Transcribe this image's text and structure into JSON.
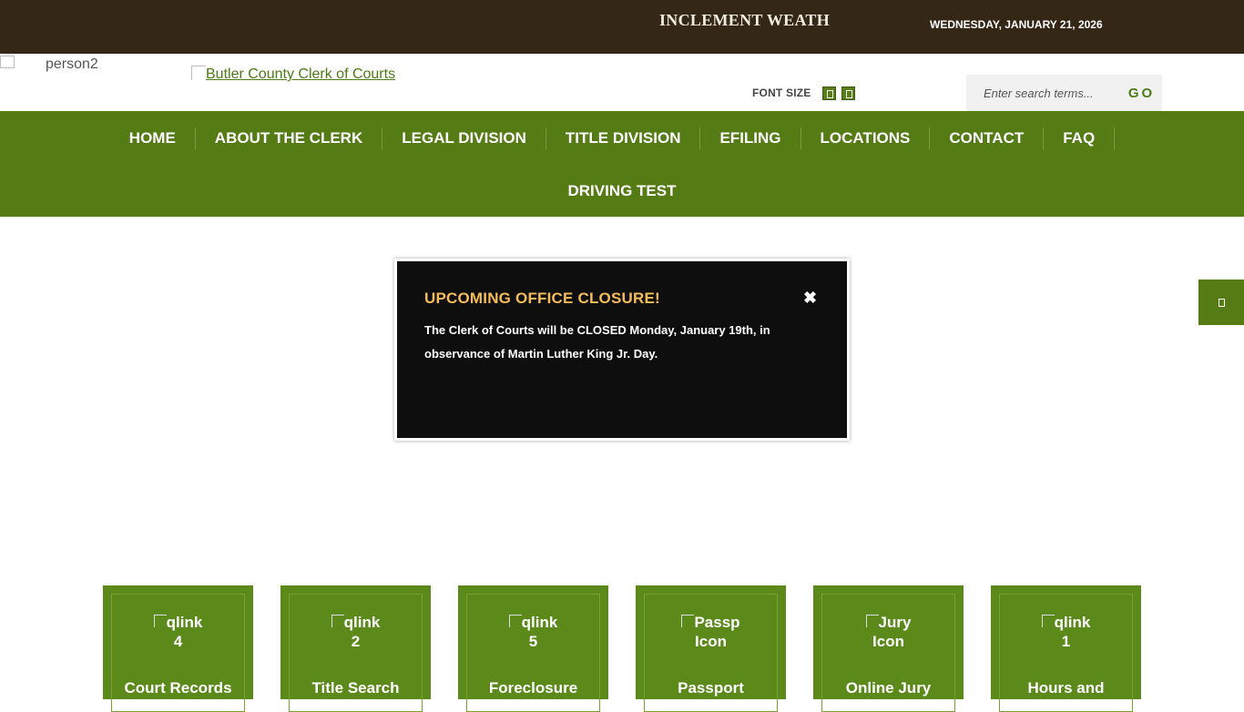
{
  "topbar": {
    "ticker": "INCLEMENT WEATH",
    "date": "WEDNESDAY, JANUARY 21, 2026"
  },
  "header": {
    "person_alt": "person2",
    "logo_alt": "Butler County Clerk of Courts",
    "font_size_label": "FONT SIZE",
    "search_placeholder": "Enter search terms...",
    "search_button": "GO"
  },
  "nav": {
    "items": [
      "HOME",
      "ABOUT THE CLERK",
      "LEGAL DIVISION",
      "TITLE DIVISION",
      "EFILING",
      "LOCATIONS",
      "CONTACT",
      "FAQ",
      "DRIVING TEST"
    ]
  },
  "modal": {
    "title": "UPCOMING OFFICE CLOSURE!",
    "close": "✖",
    "body": "The Clerk of Courts will be CLOSED Monday, January 19th, in observance of Martin Luther King Jr. Day."
  },
  "tiles": [
    {
      "img_alt_1": "qlink",
      "img_alt_2": "4",
      "label": "Court Records"
    },
    {
      "img_alt_1": "qlink",
      "img_alt_2": "2",
      "label": "Title Search"
    },
    {
      "img_alt_1": "qlink",
      "img_alt_2": "5",
      "label": "Foreclosure"
    },
    {
      "img_alt_1": "Passp",
      "img_alt_2": "Icon",
      "label": "Passport"
    },
    {
      "img_alt_1": "Jury",
      "img_alt_2": "Icon",
      "label": "Online Jury"
    },
    {
      "img_alt_1": "qlink",
      "img_alt_2": "1",
      "label": "Hours and"
    }
  ],
  "colors": {
    "topbar": "#342716",
    "nav_green": "#557b14",
    "tile_green": "#5b8a1a",
    "modal_title": "#f5bd5a"
  }
}
